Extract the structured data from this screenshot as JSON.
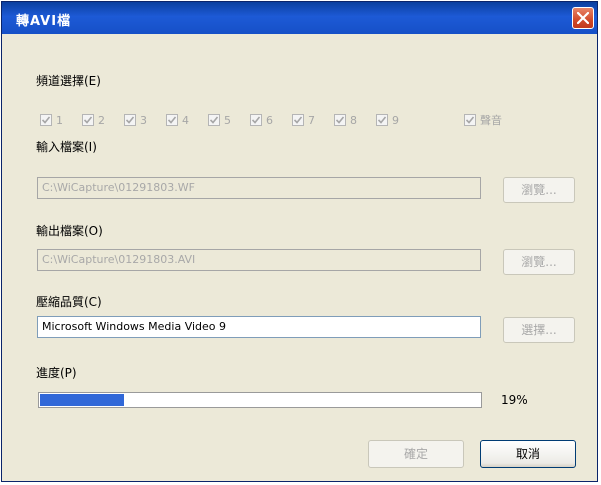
{
  "window": {
    "title": "轉AVI檔"
  },
  "channels": {
    "label": "頻道選擇(E)",
    "items": [
      "1",
      "2",
      "3",
      "4",
      "5",
      "6",
      "7",
      "8",
      "9"
    ],
    "audio_label": "聲音"
  },
  "input_file": {
    "label": "輸入檔案(I)",
    "value": "C:\\WiCapture\\01291803.WF",
    "browse_label": "瀏覽..."
  },
  "output_file": {
    "label": "輸出檔案(O)",
    "value": "C:\\WiCapture\\01291803.AVI",
    "browse_label": "瀏覽..."
  },
  "codec": {
    "label": "壓縮品質(C)",
    "value": "Microsoft Windows Media Video 9",
    "select_label": "選擇..."
  },
  "progress": {
    "label": "進度(P)",
    "value": 0.19,
    "text": "19%"
  },
  "buttons": {
    "ok": "確定",
    "cancel": "取消"
  },
  "colors": {
    "progress_fill": "#3168d8",
    "titlebar": "#1d5ad6",
    "close": "#d14a2a"
  }
}
